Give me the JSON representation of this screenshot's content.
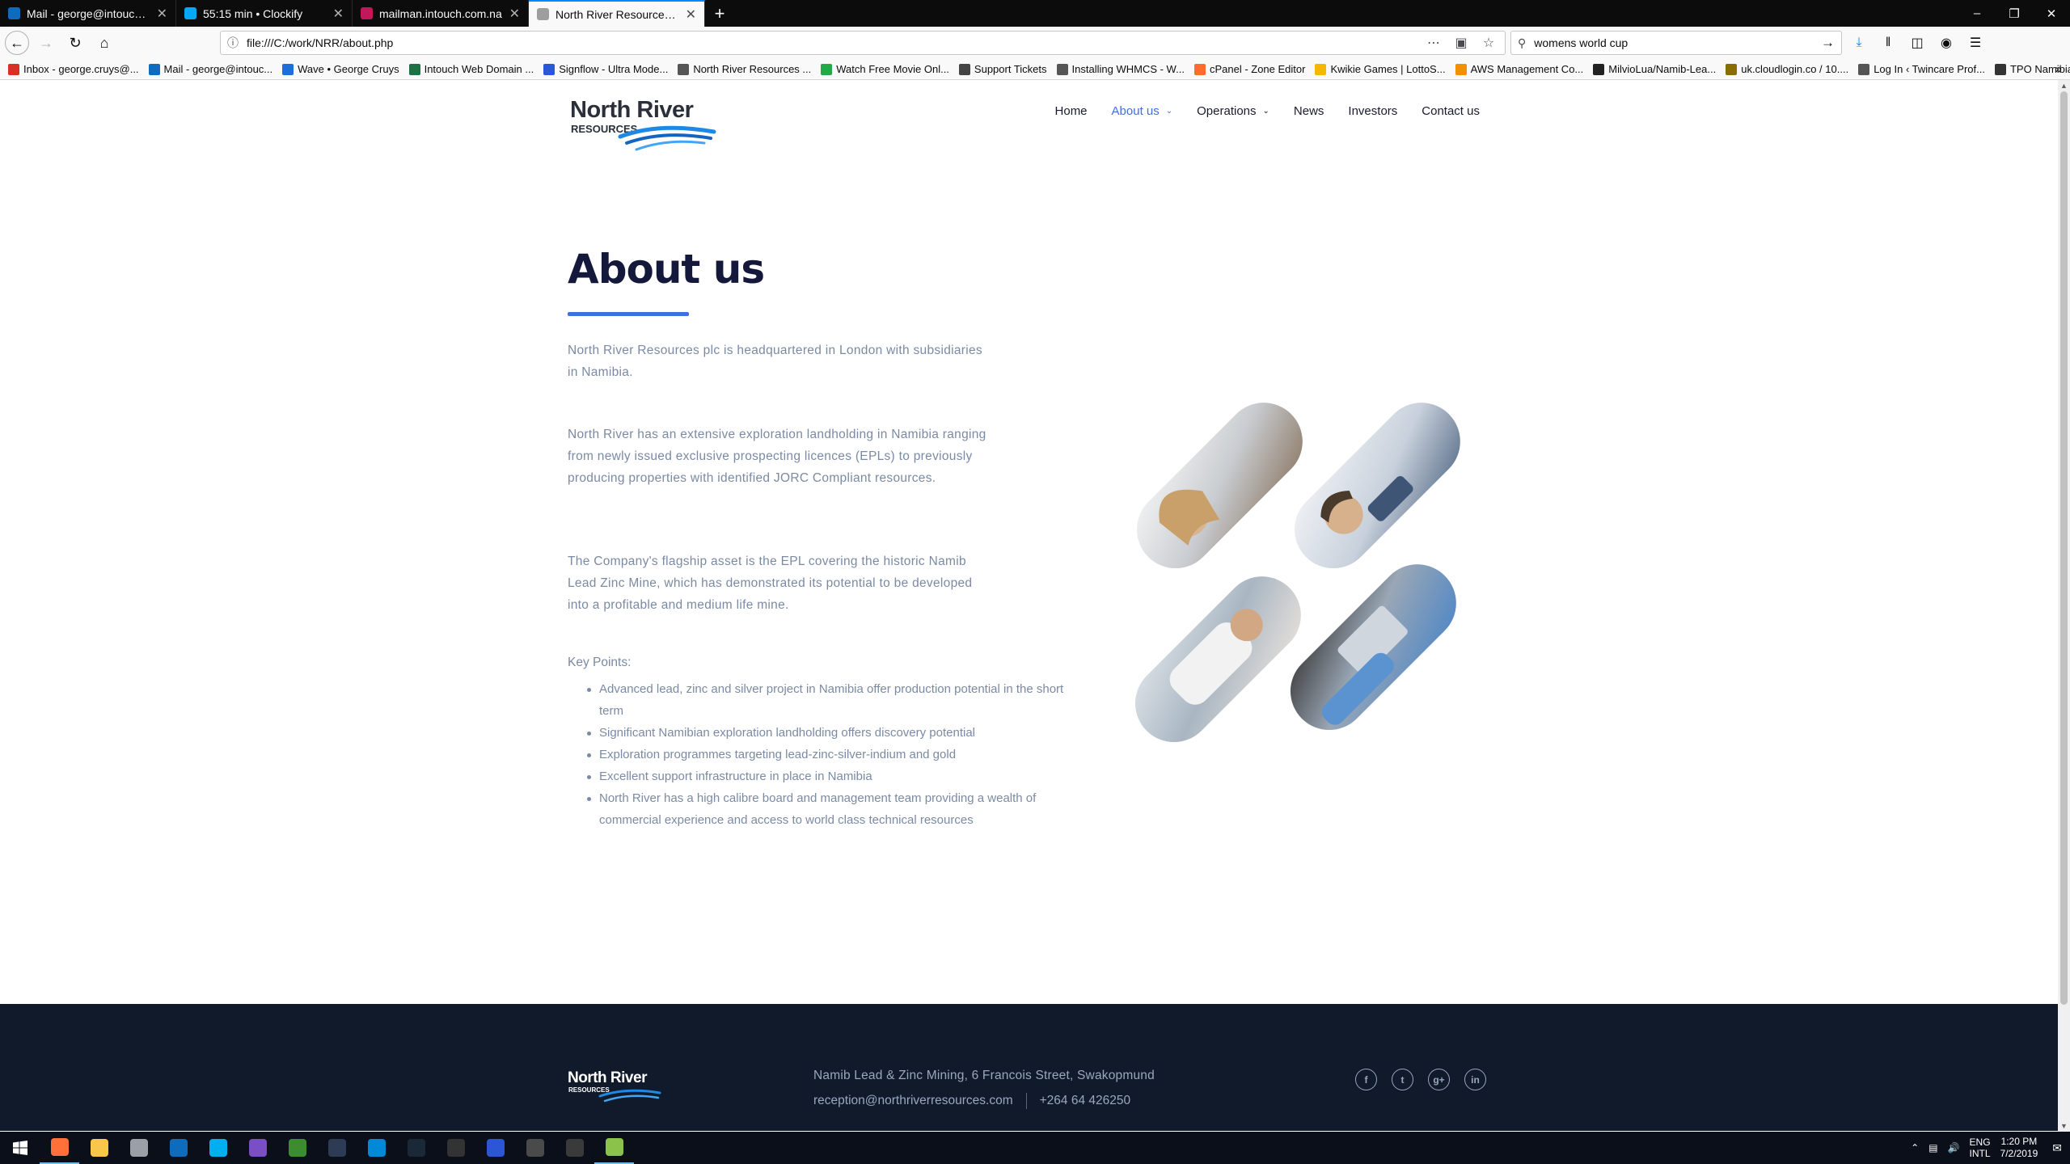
{
  "browser": {
    "tabs": [
      {
        "title": "Mail - george@intouch.com.na",
        "icon": "outlook-icon",
        "color": "#0f6cbd",
        "active": false
      },
      {
        "title": "55:15 min • Clockify",
        "icon": "clockify-icon",
        "color": "#03a9f4",
        "active": false
      },
      {
        "title": "mailman.intouch.com.na",
        "icon": "mailman-icon",
        "color": "#c2185b",
        "active": false
      },
      {
        "title": "North River Resources - About us",
        "icon": "page-icon",
        "color": "#9e9e9e",
        "active": true
      }
    ],
    "new_tab": "+",
    "url": "file:///C:/work/NRR/about.php",
    "search_query": "womens world cup",
    "bookmarks": [
      {
        "label": "Inbox - george.cruys@...",
        "icon": "gmail-icon",
        "color": "#d93025"
      },
      {
        "label": "Mail - george@intouc...",
        "icon": "outlook-icon",
        "color": "#0f6cbd"
      },
      {
        "label": "Wave • George Cruys",
        "icon": "wave-icon",
        "color": "#1c6fdb"
      },
      {
        "label": "Intouch Web Domain ...",
        "icon": "sheet-icon",
        "color": "#1e7145"
      },
      {
        "label": "Signflow - Ultra Mode...",
        "icon": "signflow-icon",
        "color": "#2b57d6"
      },
      {
        "label": "North River Resources ...",
        "icon": "globe-icon",
        "color": "#555555"
      },
      {
        "label": "Watch Free Movie Onl...",
        "icon": "movie-icon",
        "color": "#22aa44"
      },
      {
        "label": "Support Tickets",
        "icon": "support-icon",
        "color": "#444444"
      },
      {
        "label": "Installing WHMCS - W...",
        "icon": "globe-icon",
        "color": "#555555"
      },
      {
        "label": "cPanel - Zone Editor",
        "icon": "cpanel-icon",
        "color": "#ff6c2c"
      },
      {
        "label": "Kwikie Games | LottoS...",
        "icon": "star-icon",
        "color": "#f5b800"
      },
      {
        "label": "AWS Management Co...",
        "icon": "aws-icon",
        "color": "#f29100"
      },
      {
        "label": "MilvioLua/Namib-Lea...",
        "icon": "github-icon",
        "color": "#222222"
      },
      {
        "label": "uk.cloudlogin.co / 10....",
        "icon": "cloudlogin-icon",
        "color": "#8a6d00"
      },
      {
        "label": "Log In ‹ Twincare Prof...",
        "icon": "globe-icon",
        "color": "#555555"
      },
      {
        "label": "TPO Namibia",
        "icon": "home-icon",
        "color": "#333333"
      }
    ]
  },
  "site": {
    "nav": [
      {
        "label": "Home",
        "active": false,
        "has_dropdown": false
      },
      {
        "label": "About us",
        "active": true,
        "has_dropdown": true
      },
      {
        "label": "Operations",
        "active": false,
        "has_dropdown": true
      },
      {
        "label": "News",
        "active": false,
        "has_dropdown": false
      },
      {
        "label": "Investors",
        "active": false,
        "has_dropdown": false
      },
      {
        "label": "Contact us",
        "active": false,
        "has_dropdown": false
      }
    ],
    "logo": {
      "line1": "North River",
      "line2": "RESOURCES"
    },
    "title": "About us",
    "paragraphs": [
      "North River Resources plc is headquartered in London with subsidiaries in Namibia.",
      "North River has an extensive exploration landholding in Namibia ranging from newly issued exclusive prospecting licences (EPLs) to previously producing properties with identified JORC Compliant resources.",
      "The Company's flagship asset is the EPL covering the historic Namib Lead Zinc Mine, which has demonstrated its potential to be developed into a profitable and medium life mine."
    ],
    "key_points_label": "Key Points:",
    "key_points": [
      "Advanced lead, zinc and silver project in Namibia offer production potential in the short term",
      "Significant Namibian exploration landholding offers discovery potential",
      "Exploration programmes targeting lead-zinc-silver-indium and gold",
      "Excellent support infrastructure in place in Namibia",
      "North River has a high calibre board and management team providing a wealth of commercial experience and access to world class technical resources"
    ],
    "footer": {
      "address": "Namib Lead & Zinc Mining, 6 Francois Street, Swakopmund",
      "email": "reception@northriverresources.com",
      "phone": "+264 64 426250",
      "social": [
        {
          "icon": "facebook-icon",
          "glyph": "f"
        },
        {
          "icon": "twitter-icon",
          "glyph": "t"
        },
        {
          "icon": "google-plus-icon",
          "glyph": "g+"
        },
        {
          "icon": "linkedin-icon",
          "glyph": "in"
        }
      ]
    },
    "colors": {
      "accent": "#3f6fe0",
      "navy": "#14183a",
      "footer_bg": "#101a2b"
    }
  },
  "taskbar": {
    "apps": [
      {
        "icon": "firefox-icon",
        "color": "#ff7139",
        "open": true
      },
      {
        "icon": "file-explorer-icon",
        "color": "#f8c64a",
        "open": false
      },
      {
        "icon": "printer-icon",
        "color": "#9aa0a6",
        "open": false
      },
      {
        "icon": "mail-app-icon",
        "color": "#0f6cbd",
        "open": false
      },
      {
        "icon": "skype-icon",
        "color": "#00aff0",
        "open": false
      },
      {
        "icon": "visual-studio-icon",
        "color": "#7b4fc4",
        "open": false
      },
      {
        "icon": "game-icon",
        "color": "#3c8d2f",
        "open": false
      },
      {
        "icon": "app-icon",
        "color": "#2e3b55",
        "open": false
      },
      {
        "icon": "azure-icon",
        "color": "#0089d6",
        "open": false
      },
      {
        "icon": "steam-icon",
        "color": "#1b2838",
        "open": false
      },
      {
        "icon": "epic-games-icon",
        "color": "#333333",
        "open": false
      },
      {
        "icon": "signflow-icon",
        "color": "#2b57d6",
        "open": false
      },
      {
        "icon": "chrome-icon",
        "color": "#4a4a4a",
        "open": false
      },
      {
        "icon": "alienware-icon",
        "color": "#3a3a3a",
        "open": false
      },
      {
        "icon": "notepad-plus-icon",
        "color": "#8bc34a",
        "open": true
      }
    ],
    "lang_line1": "ENG",
    "lang_line2": "INTL",
    "time": "1:20 PM",
    "date": "7/2/2019"
  }
}
